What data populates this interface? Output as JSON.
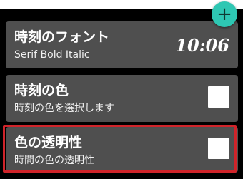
{
  "colors": {
    "background": "#000000",
    "card": "#4f4f4f",
    "accent": "#2ec7b3",
    "highlight_border": "#d0242a"
  },
  "fab": {
    "icon": "plus-icon",
    "glyph": "+"
  },
  "settings": [
    {
      "title": "時刻のフォント",
      "subtitle": "Serif Bold Italic",
      "value": "10:06"
    },
    {
      "title": "時刻の色",
      "subtitle": "時刻の色を選択します",
      "checked": false
    },
    {
      "title": "色の透明性",
      "subtitle": "時間の色の透明性",
      "checked": false
    }
  ]
}
